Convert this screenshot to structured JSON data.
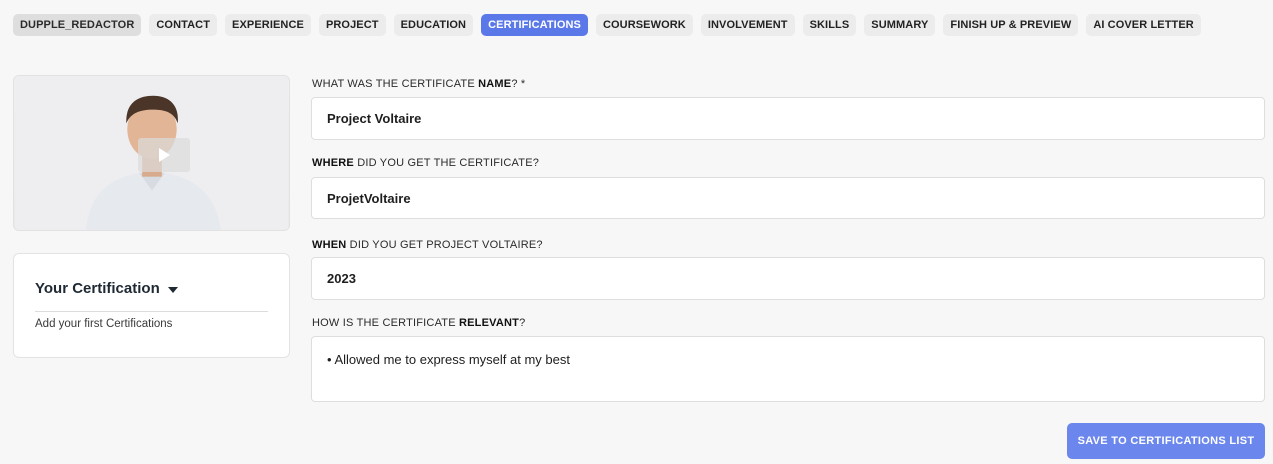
{
  "tabs": [
    {
      "label": "DUPPLE_REDACTOR"
    },
    {
      "label": "CONTACT"
    },
    {
      "label": "EXPERIENCE"
    },
    {
      "label": "PROJECT"
    },
    {
      "label": "EDUCATION"
    },
    {
      "label": "CERTIFICATIONS"
    },
    {
      "label": "COURSEWORK"
    },
    {
      "label": "INVOLVEMENT"
    },
    {
      "label": "SKILLS"
    },
    {
      "label": "SUMMARY"
    },
    {
      "label": "FINISH UP & PREVIEW"
    },
    {
      "label": "AI COVER LETTER"
    }
  ],
  "active_tab": "CERTIFICATIONS",
  "sidebar": {
    "card_title": "Your Certification",
    "empty_text": "Add your first Certifications"
  },
  "form": {
    "name_label_pre": "WHAT WAS THE CERTIFICATE ",
    "name_label_bold": "NAME",
    "name_label_post": "? *",
    "name_value": "Project Voltaire",
    "where_label_bold": "WHERE",
    "where_label_post": " DID YOU GET THE CERTIFICATE?",
    "where_value": "ProjetVoltaire",
    "when_label_bold": "WHEN",
    "when_label_post": " DID YOU GET PROJECT VOLTAIRE?",
    "when_value": "2023",
    "relevant_label_pre": "HOW IS THE CERTIFICATE ",
    "relevant_label_bold": "RELEVANT",
    "relevant_label_post": "?",
    "relevant_value": "• Allowed me to express myself at my best"
  },
  "actions": {
    "save_label": "SAVE TO CERTIFICATIONS LIST"
  },
  "colors": {
    "accent": "#5b78e8",
    "save_button": "#6b86ec"
  },
  "icons": {
    "play": "play-icon",
    "caret": "caret-down-icon"
  }
}
